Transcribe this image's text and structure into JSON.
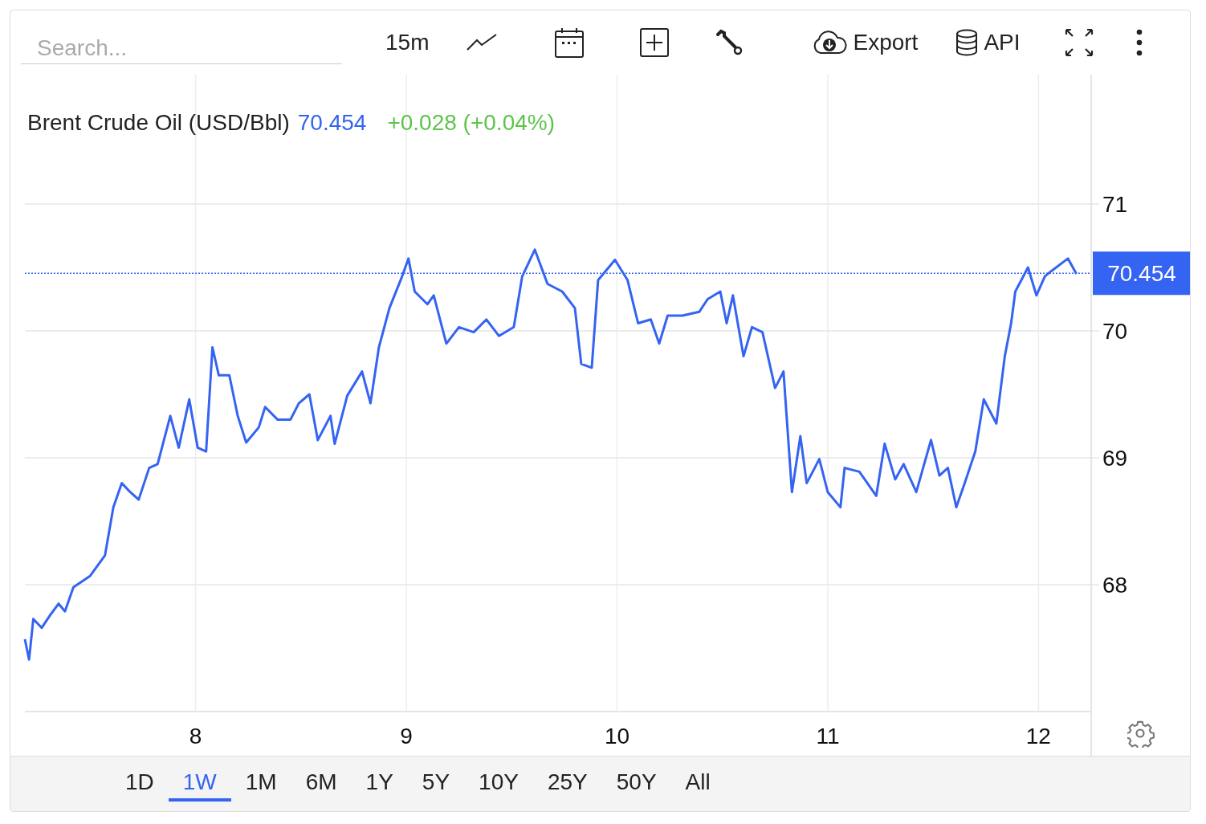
{
  "toolbar": {
    "search": {
      "placeholder": "Search..."
    },
    "interval": "15m",
    "export": "Export",
    "api": "API"
  },
  "chart": {
    "title": "Brent Crude Oil (USD/Bbl)",
    "price": "70.454",
    "change": "+0.028 (+0.04%)",
    "last_value_label": "70.454",
    "chart_data": {
      "type": "line",
      "xlim": [
        7.19,
        12.25
      ],
      "ylim": [
        67,
        72
      ],
      "xticks": [
        8,
        9,
        10,
        11,
        12
      ],
      "yticks": [
        68,
        69,
        70,
        71
      ],
      "x": [
        7.19,
        7.21,
        7.23,
        7.27,
        7.31,
        7.35,
        7.38,
        7.42,
        7.5,
        7.57,
        7.61,
        7.65,
        7.69,
        7.73,
        7.78,
        7.82,
        7.88,
        7.92,
        7.97,
        8.01,
        8.05,
        8.08,
        8.11,
        8.16,
        8.2,
        8.24,
        8.3,
        8.33,
        8.39,
        8.45,
        8.49,
        8.54,
        8.58,
        8.64,
        8.66,
        8.72,
        8.79,
        8.83,
        8.87,
        8.92,
        8.98,
        9.01,
        9.04,
        9.1,
        9.13,
        9.19,
        9.25,
        9.32,
        9.38,
        9.44,
        9.51,
        9.55,
        9.61,
        9.67,
        9.74,
        9.8,
        9.83,
        9.88,
        9.91,
        9.99,
        10.05,
        10.1,
        10.16,
        10.2,
        10.24,
        10.31,
        10.39,
        10.43,
        10.49,
        10.52,
        10.55,
        10.6,
        10.64,
        10.69,
        10.75,
        10.79,
        10.83,
        10.87,
        10.9,
        10.96,
        11.0,
        11.06,
        11.08,
        11.15,
        11.23,
        11.27,
        11.32,
        11.36,
        11.42,
        11.49,
        11.53,
        11.57,
        11.61,
        11.65,
        11.7,
        11.74,
        11.8,
        11.84,
        11.87,
        11.89,
        11.95,
        11.99,
        12.03,
        12.06,
        12.14,
        12.18
      ],
      "series": [
        {
          "color": "#3563f2",
          "values": [
            67.57,
            67.41,
            67.73,
            67.66,
            67.76,
            67.85,
            67.79,
            67.98,
            68.07,
            68.23,
            68.61,
            68.8,
            68.73,
            68.67,
            68.92,
            68.95,
            69.33,
            69.08,
            69.46,
            69.08,
            69.05,
            69.87,
            69.65,
            69.65,
            69.33,
            69.12,
            69.24,
            69.4,
            69.3,
            69.3,
            69.43,
            69.5,
            69.14,
            69.33,
            69.11,
            69.49,
            69.68,
            69.43,
            69.87,
            70.18,
            70.43,
            70.57,
            70.31,
            70.21,
            70.28,
            69.9,
            70.03,
            69.99,
            70.09,
            69.96,
            70.03,
            70.43,
            70.64,
            70.37,
            70.31,
            70.18,
            69.74,
            69.71,
            70.4,
            70.56,
            70.4,
            70.06,
            70.09,
            69.9,
            70.12,
            70.12,
            70.15,
            70.25,
            70.31,
            70.06,
            70.28,
            69.8,
            70.03,
            69.99,
            69.55,
            69.68,
            68.73,
            69.17,
            68.8,
            68.99,
            68.73,
            68.61,
            68.92,
            68.89,
            68.7,
            69.11,
            68.83,
            68.95,
            68.73,
            69.14,
            68.86,
            68.92,
            68.61,
            68.8,
            69.05,
            69.46,
            69.27,
            69.8,
            70.06,
            70.31,
            70.5,
            70.28,
            70.43,
            70.47,
            70.57,
            70.45
          ]
        }
      ],
      "grid": true,
      "ref_lines": [
        {
          "axis": "y",
          "value": 70.454,
          "color": "#3563f2"
        }
      ]
    }
  },
  "ranges": [
    {
      "label": "1D",
      "selected": false
    },
    {
      "label": "1W",
      "selected": true
    },
    {
      "label": "1M",
      "selected": false
    },
    {
      "label": "6M",
      "selected": false
    },
    {
      "label": "1Y",
      "selected": false
    },
    {
      "label": "5Y",
      "selected": false
    },
    {
      "label": "10Y",
      "selected": false
    },
    {
      "label": "25Y",
      "selected": false
    },
    {
      "label": "50Y",
      "selected": false
    },
    {
      "label": "All",
      "selected": false
    }
  ]
}
